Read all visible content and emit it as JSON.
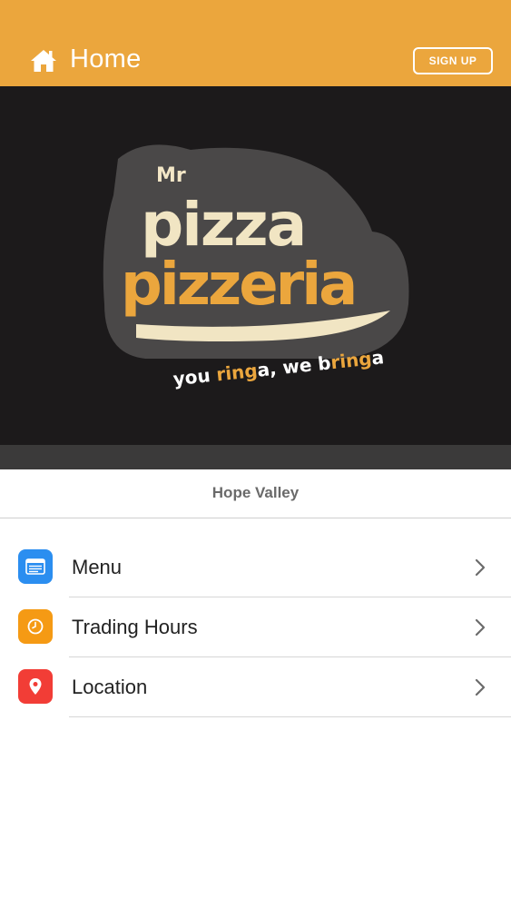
{
  "header": {
    "title": "Home",
    "signup_label": "SIGN UP",
    "background": "#eba63d"
  },
  "hero": {
    "logo": {
      "top_word": "Mr",
      "word1": "pizza",
      "word2": "pizzeria",
      "tagline_parts": [
        "you ",
        "ring",
        "a",
        ", we b",
        "ring",
        "a"
      ]
    }
  },
  "location": {
    "name": "Hope Valley"
  },
  "menu_items": [
    {
      "label": "Menu",
      "icon": "list-icon",
      "icon_color": "#2b8ef0"
    },
    {
      "label": "Trading Hours",
      "icon": "clock-icon",
      "icon_color": "#f59a14"
    },
    {
      "label": "Location",
      "icon": "map-pin-icon",
      "icon_color": "#f23d36"
    }
  ]
}
